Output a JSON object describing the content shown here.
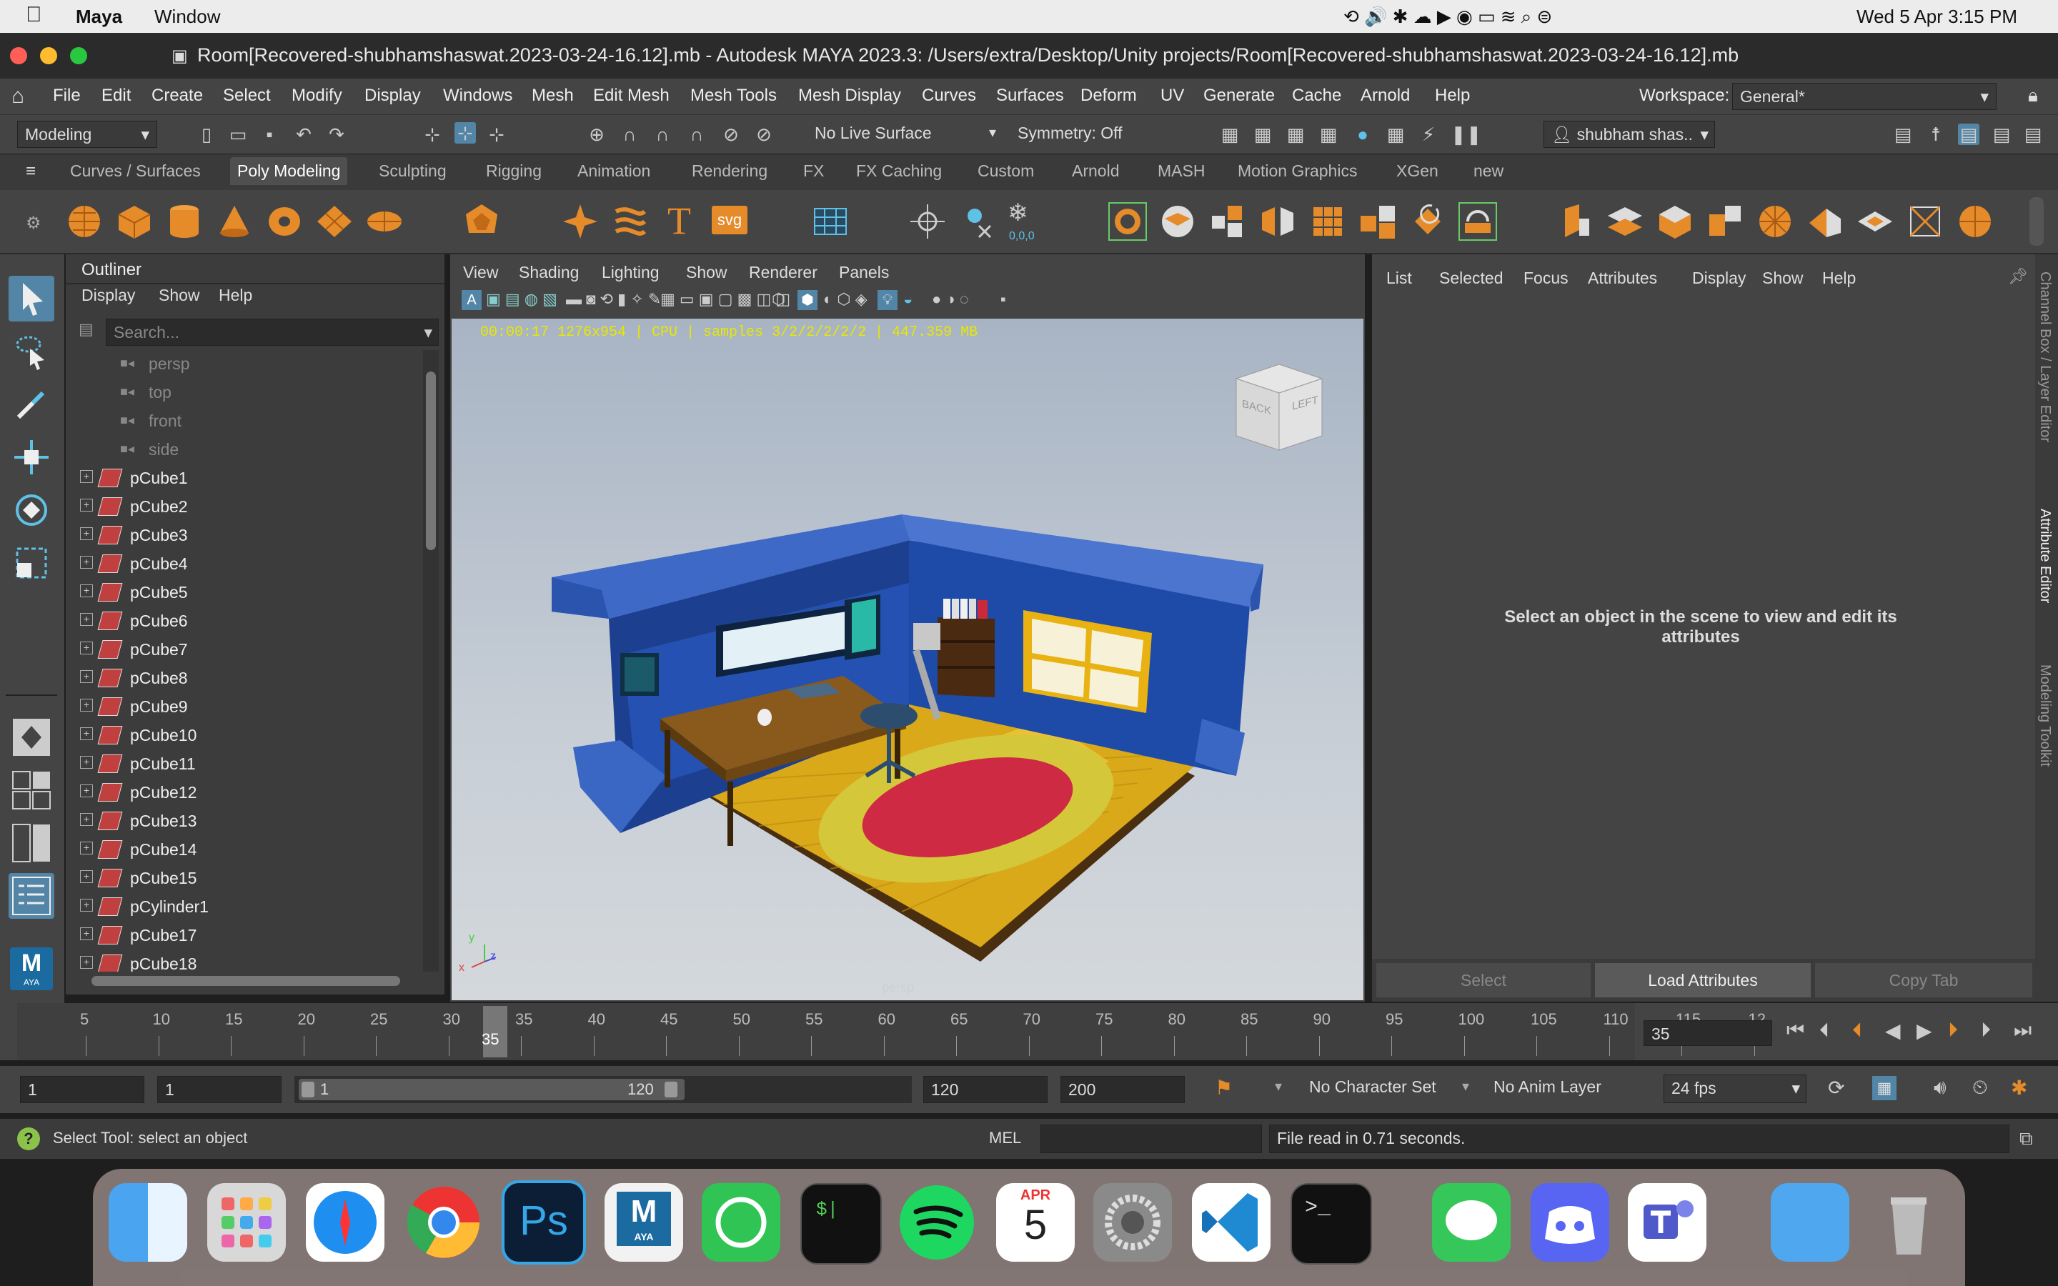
{
  "macbar": {
    "app": "Maya",
    "menu": "Window",
    "datetime": "Wed 5 Apr  3:15 PM"
  },
  "window": {
    "title": "Room[Recovered-shubhamshaswat.2023-03-24-16.12].mb - Autodesk MAYA 2023.3: /Users/extra/Desktop/Unity projects/Room[Recovered-shubhamshaswat.2023-03-24-16.12].mb"
  },
  "menu": {
    "items": [
      "File",
      "Edit",
      "Create",
      "Select",
      "Modify",
      "Display",
      "Windows",
      "Mesh",
      "Edit Mesh",
      "Mesh Tools",
      "Mesh Display",
      "Curves",
      "Surfaces",
      "Deform",
      "UV",
      "Generate",
      "Cache",
      "Arnold",
      "Help"
    ],
    "workspace_label": "Workspace:",
    "workspace_value": "General*"
  },
  "statusline": {
    "mode": "Modeling",
    "live_surface": "No Live Surface",
    "symmetry": "Symmetry: Off",
    "user": "shubham shas.."
  },
  "shelf": {
    "tabs": [
      "Curves / Surfaces",
      "Poly Modeling",
      "Sculpting",
      "Rigging",
      "Animation",
      "Rendering",
      "FX",
      "FX Caching",
      "Custom",
      "Arnold",
      "MASH",
      "Motion Graphics",
      "XGen",
      "new"
    ],
    "active": "Poly Modeling",
    "icon_labels": {
      "text_tool": "T",
      "svg_tool": "svg",
      "coords": "0,0,0"
    }
  },
  "outliner": {
    "title": "Outliner",
    "menu": [
      "Display",
      "Show",
      "Help"
    ],
    "search_placeholder": "Search...",
    "cameras": [
      "persp",
      "top",
      "front",
      "side"
    ],
    "items": [
      "pCube1",
      "pCube2",
      "pCube3",
      "pCube4",
      "pCube5",
      "pCube6",
      "pCube7",
      "pCube8",
      "pCube9",
      "pCube10",
      "pCube11",
      "pCube12",
      "pCube13",
      "pCube14",
      "pCube15",
      "pCylinder1",
      "pCube17",
      "pCube18"
    ]
  },
  "viewport": {
    "menu": [
      "View",
      "Shading",
      "Lighting",
      "Show",
      "Renderer",
      "Panels"
    ],
    "hud": "00:00:17 1276x954 | CPU | samples 3/2/2/2/2/2 | 447.359 MB",
    "cube_labels": [
      "BACK",
      "LEFT"
    ],
    "camera": "persp",
    "axes": {
      "x": "x",
      "y": "y",
      "z": "z"
    }
  },
  "attribute_editor": {
    "menu": [
      "List",
      "Selected",
      "Focus",
      "Attributes",
      "Display",
      "Show",
      "Help"
    ],
    "message": "Select an object in the scene to view and edit its attributes",
    "buttons": [
      "Select",
      "Load Attributes",
      "Copy Tab"
    ]
  },
  "side_tabs": [
    "Channel Box / Layer Editor",
    "Attribute Editor",
    "Modeling Toolkit"
  ],
  "timeline": {
    "ticks": [
      "5",
      "10",
      "15",
      "20",
      "25",
      "30",
      "35",
      "40",
      "45",
      "50",
      "55",
      "60",
      "65",
      "70",
      "75",
      "80",
      "85",
      "90",
      "95",
      "100",
      "105",
      "110",
      "115",
      "12"
    ],
    "current_frame": "35",
    "current_frame_field": "35"
  },
  "range": {
    "start": "1",
    "anim_start": "1",
    "slider_start": "1",
    "slider_end": "120",
    "playback_end": "120",
    "anim_end": "200",
    "character_set": "No Character Set",
    "anim_layer": "No Anim Layer",
    "fps": "24 fps"
  },
  "helpline": {
    "message": "Select Tool: select an object",
    "lang": "MEL",
    "result": "File read in  0.71 seconds."
  },
  "dock": {
    "calendar_month": "APR",
    "calendar_day": "5",
    "ps_label": "Ps",
    "maya_label": "M",
    "maya_sub": "AYA"
  }
}
